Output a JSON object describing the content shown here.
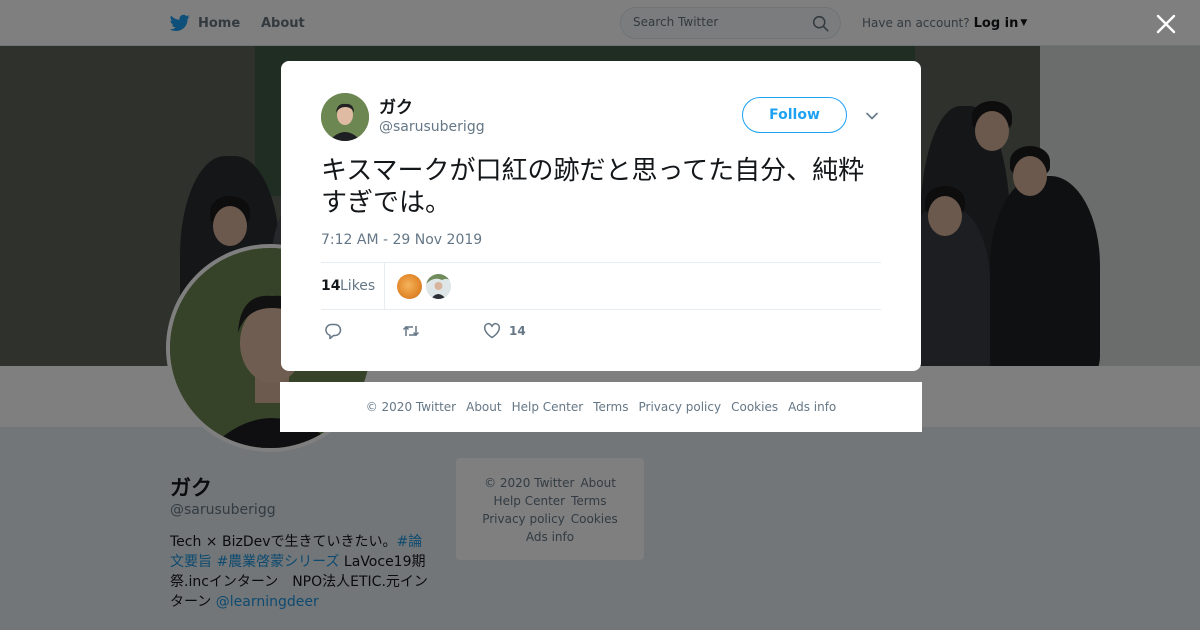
{
  "topbar": {
    "home_label": "Home",
    "about_label": "About",
    "search_placeholder": "Search Twitter",
    "have_account": "Have an account?",
    "login_label": "Log in"
  },
  "profile": {
    "name": "ガク",
    "handle": "@sarusuberigg",
    "bio_text1": "Tech × BizDevで生きていきたい。",
    "bio_tag1": "#論文要旨",
    "bio_tag2": "#農業啓蒙シリーズ",
    "bio_text2": " LaVoce19期祭.incインターン　NPO法人ETIC.元インターン ",
    "bio_mention": "@learningdeer"
  },
  "sidebar_footer": {
    "copyright": "© 2020 Twitter",
    "about": "About",
    "help": "Help Center",
    "terms": "Terms",
    "privacy": "Privacy policy",
    "cookies": "Cookies",
    "ads": "Ads info"
  },
  "tweet": {
    "name": "ガク",
    "handle": "@sarusuberigg",
    "follow_label": "Follow",
    "text": "キスマークが口紅の跡だと思ってた自分、純粋すぎでは。",
    "timestamp": "7:12 AM - 29 Nov 2019",
    "likes_count": "14",
    "likes_label": "Likes",
    "like_action_count": "14"
  },
  "modal_footer": {
    "copyright": "© 2020 Twitter",
    "about": "About",
    "help": "Help Center",
    "terms": "Terms",
    "privacy": "Privacy policy",
    "cookies": "Cookies",
    "ads": "Ads info"
  },
  "colors": {
    "twitter_blue": "#1da1f2",
    "text_primary": "#14171a",
    "text_secondary": "#657786"
  }
}
